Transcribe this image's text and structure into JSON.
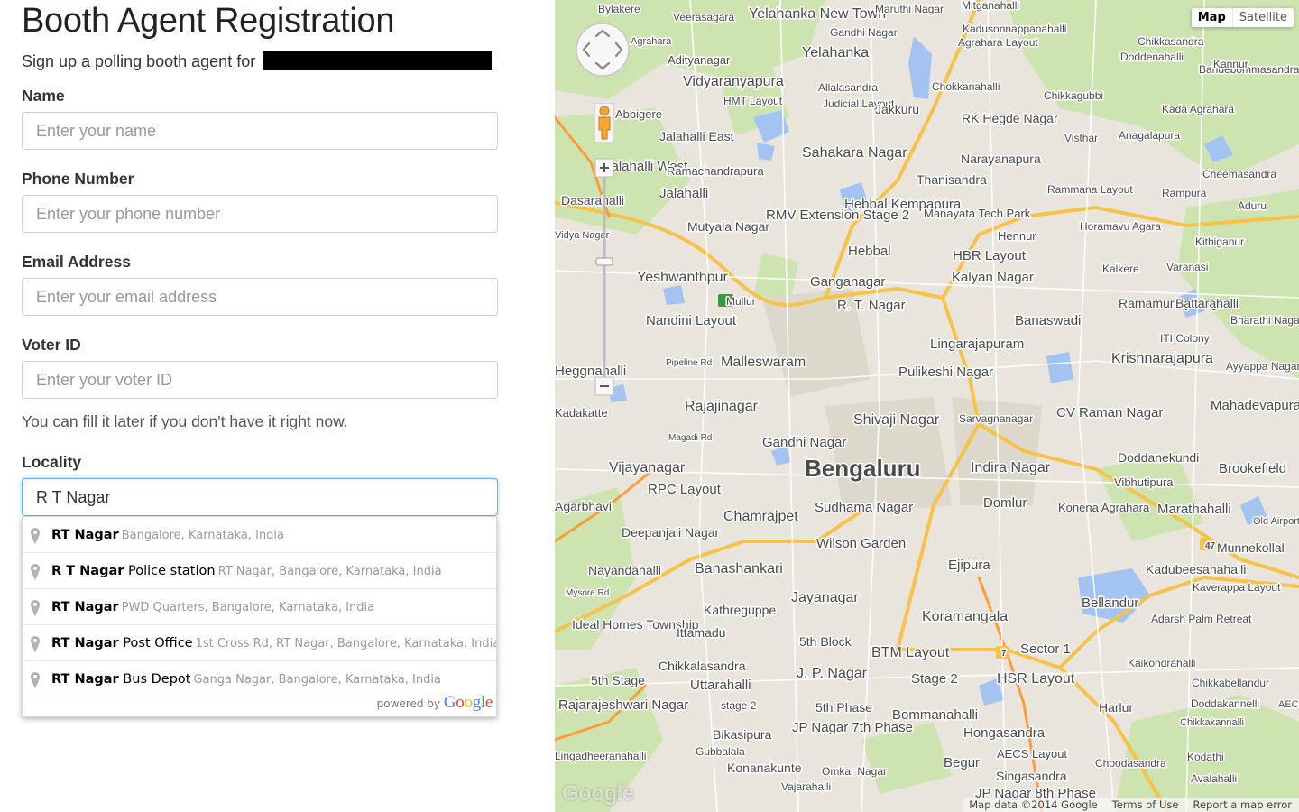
{
  "page_title": "Booth Agent Registration",
  "subtitle": "Sign up a polling booth agent for",
  "form": {
    "fields": [
      {
        "label": "Name",
        "placeholder": "Enter your name"
      },
      {
        "label": "Phone Number",
        "placeholder": "Enter your phone number"
      },
      {
        "label": "Email Address",
        "placeholder": "Enter your email address"
      },
      {
        "label": "Voter ID",
        "placeholder": "Enter your voter ID"
      }
    ],
    "voter_help": "You can fill it later if you don't have it right now.",
    "locality_label": "Locality",
    "locality_value": "R T Nagar"
  },
  "autocomplete": {
    "suggestions": [
      {
        "match": "RT Nagar",
        "rest": "",
        "secondary": "Bangalore, Karnataka, India"
      },
      {
        "match": "R T Nagar",
        "rest": " Police station",
        "secondary": "RT Nagar, Bangalore, Karnataka, India"
      },
      {
        "match": "RT Nagar",
        "rest": "",
        "secondary": "PWD Quarters, Bangalore, Karnataka, India"
      },
      {
        "match": "RT Nagar",
        "rest": " Post Office",
        "secondary": "1st Cross Rd, RT Nagar, Bangalore, Karnataka, India"
      },
      {
        "match": "RT Nagar",
        "rest": " Bus Depot",
        "secondary": "Ganga Nagar, Bangalore, Karnataka, India"
      }
    ],
    "powered_by": "powered by",
    "brand": "Google"
  },
  "map": {
    "type_buttons": {
      "map": "Map",
      "satellite": "Satellite"
    },
    "footer": {
      "data": "Map data ©2014 Google",
      "terms": "Terms of Use",
      "report": "Report a map error"
    },
    "watermark": "Google",
    "labels": [
      {
        "text": "Bengaluru",
        "size": 26,
        "bold": true
      },
      {
        "text": "Bylakere",
        "size": 12
      },
      {
        "text": "Veerasagara",
        "size": 12
      },
      {
        "text": "Yelahanka New Town",
        "size": 16
      },
      {
        "text": "Gandhi Nagar",
        "size": 12
      },
      {
        "text": "Maruthi Nagar",
        "size": 12
      },
      {
        "text": "Mitganahalli",
        "size": 12
      },
      {
        "text": "Kadusonnappanahalli",
        "size": 12
      },
      {
        "text": "Chikkasandra",
        "size": 12
      },
      {
        "text": "Doddenahalli",
        "size": 12
      },
      {
        "text": "Bandebommasandra",
        "size": 12
      },
      {
        "text": "Agrahara",
        "size": 11
      },
      {
        "text": "Yelahanka",
        "size": 16
      },
      {
        "text": "Agrahara Layout",
        "size": 12
      },
      {
        "text": "Kannur",
        "size": 12
      },
      {
        "text": "Adityanagar",
        "size": 13
      },
      {
        "text": "Vidyaranyapura",
        "size": 16
      },
      {
        "text": "Allalasandra",
        "size": 12
      },
      {
        "text": "Chokkanahalli",
        "size": 12
      },
      {
        "text": "Chikkagubbi",
        "size": 12
      },
      {
        "text": "HMT Layout",
        "size": 12
      },
      {
        "text": "Judicial Layout",
        "size": 12
      },
      {
        "text": "Jakkuru",
        "size": 14
      },
      {
        "text": "RK Hegde Nagar",
        "size": 14
      },
      {
        "text": "Kada Agrahara",
        "size": 12
      },
      {
        "text": "Abbigere",
        "size": 13
      },
      {
        "text": "Jalahalli East",
        "size": 14
      },
      {
        "text": "Visthar",
        "size": 12
      },
      {
        "text": "Anagalapura",
        "size": 12
      },
      {
        "text": "Sahakara Nagar",
        "size": 16
      },
      {
        "text": "Narayanapura",
        "size": 14
      },
      {
        "text": "Jalahalli West",
        "size": 15
      },
      {
        "text": "Ramachandrapura",
        "size": 13
      },
      {
        "text": "Thanisandra",
        "size": 14
      },
      {
        "text": "Cheemasandra",
        "size": 12
      },
      {
        "text": "Dasarahalli",
        "size": 14
      },
      {
        "text": "Jalahalli",
        "size": 15
      },
      {
        "text": "Hebbal Kempapura",
        "size": 15
      },
      {
        "text": "Manayata Tech Park",
        "size": 13
      },
      {
        "text": "Rammana Layout",
        "size": 12
      },
      {
        "text": "Rampura",
        "size": 12
      },
      {
        "text": "Aduru",
        "size": 12
      },
      {
        "text": "Vidya Nagar",
        "size": 11
      },
      {
        "text": "Mutyala Nagar",
        "size": 14
      },
      {
        "text": "RMV Extension Stage 2",
        "size": 15
      },
      {
        "text": "Hennur",
        "size": 13
      },
      {
        "text": "Horamavu Agara",
        "size": 12
      },
      {
        "text": "Kithiganur",
        "size": 12
      },
      {
        "text": "Hebbal",
        "size": 15
      },
      {
        "text": "HBR Layout",
        "size": 15
      },
      {
        "text": "Kalkere",
        "size": 12
      },
      {
        "text": "Varanasi",
        "size": 12
      },
      {
        "text": "Yeshwanthpur",
        "size": 16
      },
      {
        "text": "Ganganagar",
        "size": 15
      },
      {
        "text": "Kalyan Nagar",
        "size": 15
      },
      {
        "text": "R. T. Nagar",
        "size": 15
      },
      {
        "text": "Ramamurthy Nagar",
        "size": 14
      },
      {
        "text": "Battarahalli",
        "size": 14
      },
      {
        "text": "Bharathi Nagar",
        "size": 12
      },
      {
        "text": "Nandini Layout",
        "size": 15
      },
      {
        "text": "Banaswadi",
        "size": 15
      },
      {
        "text": "ITI Colony",
        "size": 12
      },
      {
        "text": "Lingarajapuram",
        "size": 15
      },
      {
        "text": "Krishnarajapura",
        "size": 16
      },
      {
        "text": "Ayyappa Nagar",
        "size": 12
      },
      {
        "text": "Pipeline Rd",
        "size": 10
      },
      {
        "text": "Malleswaram",
        "size": 16
      },
      {
        "text": "Heggnahalli",
        "size": 15
      },
      {
        "text": "Pulikeshi Nagar",
        "size": 15
      },
      {
        "text": "Rajajinagar",
        "size": 16
      },
      {
        "text": "Shivaji Nagar",
        "size": 16
      },
      {
        "text": "Sarvagnanagar",
        "size": 12
      },
      {
        "text": "CV Raman Nagar",
        "size": 15
      },
      {
        "text": "Mahadevapura",
        "size": 15
      },
      {
        "text": "Kadakatte",
        "size": 13
      },
      {
        "text": "Magadi Rd",
        "size": 10
      },
      {
        "text": "Gandhi Nagar",
        "size": 15
      },
      {
        "text": "Doddanekundi",
        "size": 14
      },
      {
        "text": "Vijayanagar",
        "size": 16
      },
      {
        "text": "Indira Nagar",
        "size": 16
      },
      {
        "text": "Brookefield",
        "size": 15
      },
      {
        "text": "RPC Layout",
        "size": 15
      },
      {
        "text": "Vibhutipura",
        "size": 13
      },
      {
        "text": "Agarbhavi",
        "size": 14
      },
      {
        "text": "Chamrajpet",
        "size": 16
      },
      {
        "text": "Sudhama Nagar",
        "size": 15
      },
      {
        "text": "Domlur",
        "size": 15
      },
      {
        "text": "Konena Agrahara",
        "size": 13
      },
      {
        "text": "Marathahalli",
        "size": 15
      },
      {
        "text": "Old Airport",
        "size": 11
      },
      {
        "text": "Deepanjali Nagar",
        "size": 14
      },
      {
        "text": "Wilson Garden",
        "size": 15
      },
      {
        "text": "Munnekollal",
        "size": 14
      },
      {
        "text": "Nayandahalli",
        "size": 14
      },
      {
        "text": "Banashankari",
        "size": 16
      },
      {
        "text": "Ejipura",
        "size": 15
      },
      {
        "text": "Kadubeesanahalli",
        "size": 14
      },
      {
        "text": "Mysore Rd",
        "size": 10
      },
      {
        "text": "Jayanagar",
        "size": 16
      },
      {
        "text": "Bellandur",
        "size": 15
      },
      {
        "text": "Kaverappa Layout",
        "size": 12
      },
      {
        "text": "Kathreguppe",
        "size": 14
      },
      {
        "text": "Koramangala",
        "size": 16
      },
      {
        "text": "Ideal Homes Township",
        "size": 14
      },
      {
        "text": "Ittamadu",
        "size": 14
      },
      {
        "text": "Adarsh Palm Retreat",
        "size": 12
      },
      {
        "text": "5th Block",
        "size": 14
      },
      {
        "text": "BTM Layout",
        "size": 16
      },
      {
        "text": "Sector 1",
        "size": 15
      },
      {
        "text": "Kaikondrahalli",
        "size": 12
      },
      {
        "text": "Chikkalasandra",
        "size": 14
      },
      {
        "text": "J. P. Nagar",
        "size": 16
      },
      {
        "text": "Stage 2",
        "size": 15
      },
      {
        "text": "HSR Layout",
        "size": 16
      },
      {
        "text": "Chikkabellandur",
        "size": 12
      },
      {
        "text": "5th Stage",
        "size": 14
      },
      {
        "text": "Uttarahalli",
        "size": 15
      },
      {
        "text": "Rajarajeshwari Nagar",
        "size": 15
      },
      {
        "text": "stage 2",
        "size": 12
      },
      {
        "text": "5th Phase",
        "size": 14
      },
      {
        "text": "Bommanahalli",
        "size": 15
      },
      {
        "text": "Harlur",
        "size": 14
      },
      {
        "text": "Doddakannelli",
        "size": 12
      },
      {
        "text": "Chikkakannalli",
        "size": 11
      },
      {
        "text": "JP Nagar 7th Phase",
        "size": 15
      },
      {
        "text": "Bikasipura",
        "size": 14
      },
      {
        "text": "Hongasandra",
        "size": 15
      },
      {
        "text": "AECS Layout",
        "size": 13
      },
      {
        "text": "Gubbalala",
        "size": 12
      },
      {
        "text": "Begur",
        "size": 15
      },
      {
        "text": "Choodasandra",
        "size": 12
      },
      {
        "text": "Kodathi",
        "size": 12
      },
      {
        "text": "Lingadheeranahalli",
        "size": 12
      },
      {
        "text": "Konanakunte",
        "size": 14
      },
      {
        "text": "Omkar Nagar",
        "size": 12
      },
      {
        "text": "Singasandra",
        "size": 14
      },
      {
        "text": "Avalahalli",
        "size": 12
      },
      {
        "text": "Vajarahalli",
        "size": 12
      },
      {
        "text": "JP Nagar 8th Phase",
        "size": 15
      },
      {
        "text": "AECS C Block",
        "size": 11
      },
      {
        "text": "Mullur",
        "size": 12
      },
      {
        "text": "47",
        "size": 10
      },
      {
        "text": "7",
        "size": 10
      },
      {
        "text": "7",
        "size": 10
      }
    ]
  },
  "icons": {
    "pin": "map-pin-icon",
    "pegman": "pegman-icon",
    "pan": "pan-control-icon"
  }
}
